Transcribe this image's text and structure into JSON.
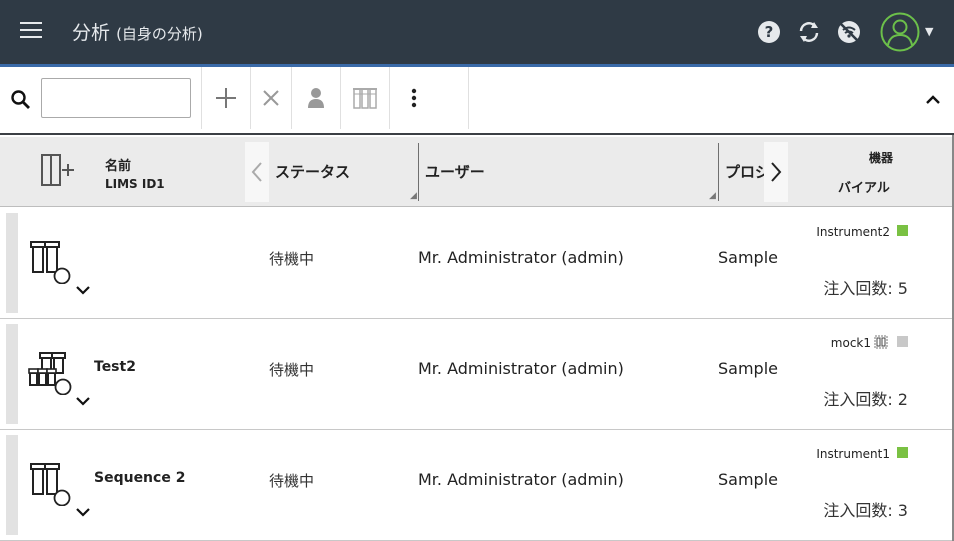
{
  "header": {
    "title": "分析",
    "subtitle": "(自身の分析)",
    "icons": [
      "menu-icon",
      "help-icon",
      "refresh-icon",
      "no-connection-icon",
      "user-avatar-icon"
    ]
  },
  "toolbar": {
    "search_value": "",
    "search_placeholder": "",
    "buttons": [
      "add-icon",
      "delete-icon",
      "user-icon",
      "vials-icon",
      "more-vertical-icon"
    ]
  },
  "columns": {
    "name": "名前",
    "lims": "LIMS ID1",
    "status": "ステータス",
    "user": "ユーザー",
    "process": "プロジ",
    "instrument": "機器",
    "vial": "バイアル"
  },
  "rows": [
    {
      "name": "",
      "status": "待機中",
      "user": "Mr. Administrator (admin)",
      "process": "Sample",
      "instrument": "Instrument2",
      "instrument_color": "#7ac143",
      "inject_label": "注入回数: 5"
    },
    {
      "name": "Test2",
      "status": "待機中",
      "user": "Mr. Administrator (admin)",
      "process": "Sample",
      "instrument": "mock1",
      "instrument_color": "#c8c8c8",
      "inject_label": "注入回数: 2"
    },
    {
      "name": "Sequence 2",
      "status": "待機中",
      "user": "Mr. Administrator (admin)",
      "process": "Sample",
      "instrument": "Instrument1",
      "instrument_color": "#7ac143",
      "inject_label": "注入回数: 3"
    }
  ],
  "colors": {
    "header_bg": "#2f3a45",
    "accent": "#3a6aa8",
    "status_ok": "#7ac143",
    "status_idle": "#c8c8c8"
  }
}
